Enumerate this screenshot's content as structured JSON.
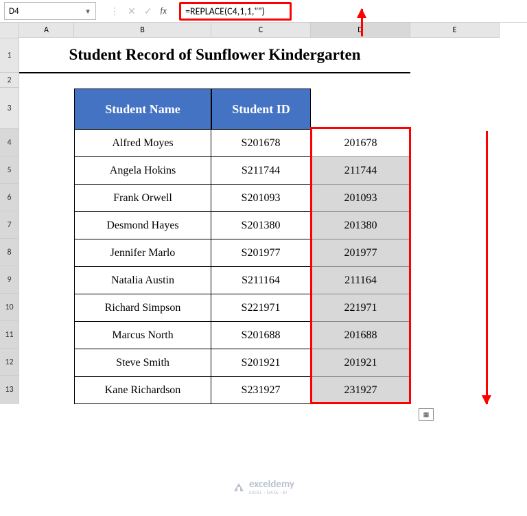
{
  "namebox": {
    "value": "D4"
  },
  "formula": {
    "text": "=REPLACE(C4,1,1,\"\")"
  },
  "columns": {
    "A": "A",
    "B": "B",
    "C": "C",
    "D": "D",
    "E": "E"
  },
  "rows": {
    "r1": "1",
    "r2": "2",
    "r3": "3",
    "r4": "4",
    "r5": "5",
    "r6": "6",
    "r7": "7",
    "r8": "8",
    "r9": "9",
    "r10": "10",
    "r11": "11",
    "r12": "12",
    "r13": "13"
  },
  "title": "Student Record of Sunflower Kindergarten",
  "headers": {
    "name": "Student Name",
    "id": "Student ID"
  },
  "data": [
    {
      "name": "Alfred Moyes",
      "id": "S201678",
      "out": "201678"
    },
    {
      "name": "Angela Hokins",
      "id": "S211744",
      "out": "211744"
    },
    {
      "name": "Frank Orwell",
      "id": "S201093",
      "out": "201093"
    },
    {
      "name": "Desmond Hayes",
      "id": "S201380",
      "out": "201380"
    },
    {
      "name": "Jennifer Marlo",
      "id": "S201977",
      "out": "201977"
    },
    {
      "name": "Natalia Austin",
      "id": "S211164",
      "out": "211164"
    },
    {
      "name": "Richard Simpson",
      "id": "S221971",
      "out": "221971"
    },
    {
      "name": "Marcus North",
      "id": "S201688",
      "out": "201688"
    },
    {
      "name": "Steve Smith",
      "id": "S201921",
      "out": "201921"
    },
    {
      "name": "Kane Richardson",
      "id": "S231927",
      "out": "231927"
    }
  ],
  "watermark": {
    "brand": "exceldemy",
    "sub": "EXCEL · DATA · BI"
  }
}
